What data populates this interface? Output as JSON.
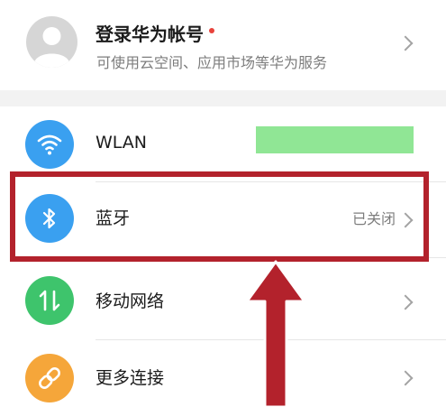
{
  "account": {
    "title": "登录华为帐号",
    "subtitle": "可使用云空间、应用市场等华为服务",
    "dot_color": "#e8423b",
    "avatar_icon": "person-icon"
  },
  "rows": [
    {
      "label": "WLAN",
      "icon": "wifi-icon",
      "icon_color": "#3aa0f0"
    },
    {
      "label": "蓝牙",
      "status": "已关闭",
      "icon": "bluetooth-icon",
      "icon_color": "#3aa0f0"
    },
    {
      "label": "移动网络",
      "icon": "mobile-data-icon",
      "icon_color": "#3ec46c"
    },
    {
      "label": "更多连接",
      "icon": "link-icon",
      "icon_color": "#f5a63a"
    }
  ],
  "annotation": {
    "highlight_color": "#b3222c",
    "redaction_color": "#90e695"
  }
}
